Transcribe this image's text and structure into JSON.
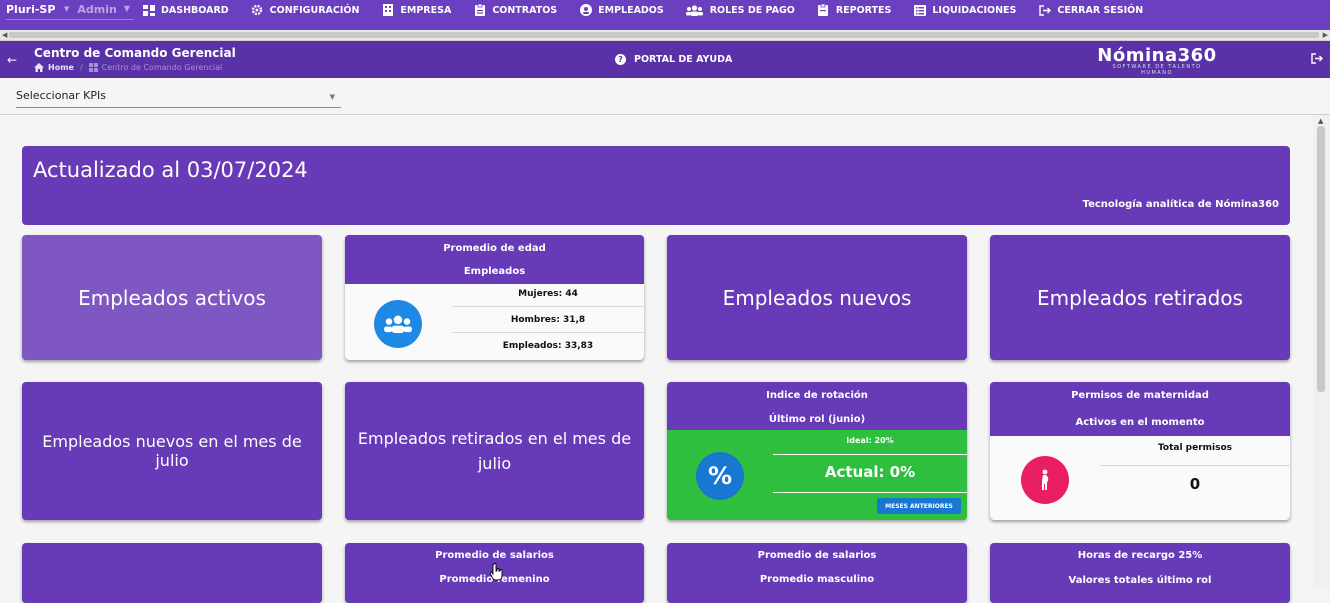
{
  "topnav": {
    "tenant": "Pluri-SP",
    "role": "Admin",
    "items": [
      {
        "label": "DASHBOARD",
        "icon": "dashboard-icon"
      },
      {
        "label": "CONFIGURACIÓN",
        "icon": "gear-icon"
      },
      {
        "label": "EMPRESA",
        "icon": "building-icon"
      },
      {
        "label": "CONTRATOS",
        "icon": "clipboard-icon"
      },
      {
        "label": "EMPLEADOS",
        "icon": "employee-icon"
      },
      {
        "label": "ROLES DE PAGO",
        "icon": "users-icon"
      },
      {
        "label": "REPORTES",
        "icon": "report-icon"
      },
      {
        "label": "LIQUIDACIONES",
        "icon": "list-icon"
      },
      {
        "label": "CERRAR SESIÓN",
        "icon": "logout-icon"
      }
    ]
  },
  "subheader": {
    "title": "Centro de Comando Gerencial",
    "breadcrumb_home": "Home",
    "breadcrumb_separator": "/",
    "breadcrumb_current": "Centro de Comando Gerencial",
    "help_label": "PORTAL DE AYUDA",
    "logo_text": "Nómina360",
    "logo_tagline": "SOFTWARE DE TALENTO HUMANO"
  },
  "kpi_select": {
    "value": "Seleccionar KPIs"
  },
  "banner": {
    "title": "Actualizado al 03/07/2024",
    "subtitle": "Tecnología analítica de Nómina360"
  },
  "cards": {
    "activos": "Empleados activos",
    "edad": {
      "title": "Promedio de edad",
      "subtitle": "Empleados",
      "rows": [
        "Mujeres: 44",
        "Hombres: 31,8",
        "Empleados: 33,83"
      ]
    },
    "nuevos": "Empleados nuevos",
    "retirados": "Empleados retirados",
    "nuevos_mes": "Empleados nuevos en el mes de julio",
    "retirados_mes": "Empleados retirados en el mes de julio",
    "rotacion": {
      "title": "Indice de rotación",
      "subtitle": "Último rol (junio)",
      "ideal": "Ideal: 20%",
      "actual": "Actual: 0%",
      "button": "MESES ANTERIORES"
    },
    "maternidad": {
      "title": "Permisos de maternidad",
      "subtitle": "Activos en el momento",
      "label": "Total permisos",
      "value": "0"
    },
    "salario_fem": {
      "title": "Promedio de salarios",
      "subtitle": "Promedio femenino"
    },
    "salario_masc": {
      "title": "Promedio de salarios",
      "subtitle": "Promedio masculino"
    },
    "recargo": {
      "title": "Horas de recargo 25%",
      "subtitle": "Valores totales último rol"
    }
  },
  "colors": {
    "primary": "#673ab7",
    "nav": "#6a3fc0",
    "green": "#2fbf3f",
    "blue": "#1976d2",
    "pink": "#e91e63"
  }
}
